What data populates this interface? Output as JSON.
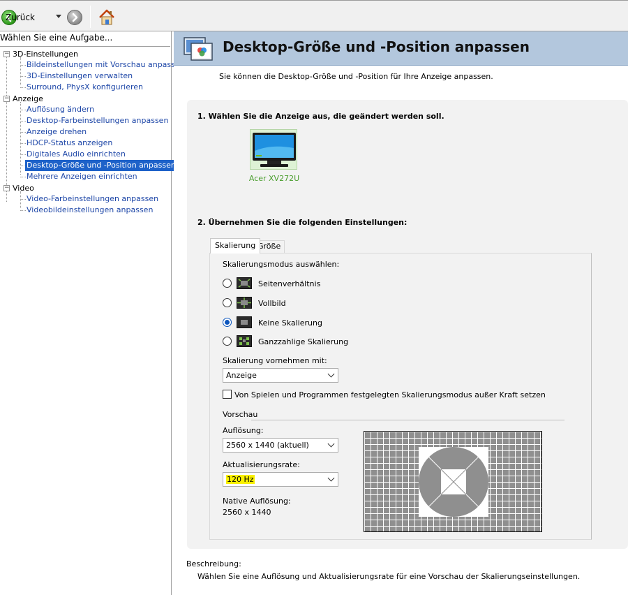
{
  "toolbar": {
    "back_label": "Zurück"
  },
  "left_panel": {
    "header": "Wählen Sie eine Aufgabe...",
    "categories": [
      {
        "label": "3D-Einstellungen",
        "items": [
          "Bildeinstellungen mit Vorschau anpassen",
          "3D-Einstellungen verwalten",
          "Surround, PhysX konfigurieren"
        ]
      },
      {
        "label": "Anzeige",
        "items": [
          "Auflösung ändern",
          "Desktop-Farbeinstellungen anpassen",
          "Anzeige drehen",
          "HDCP-Status anzeigen",
          "Digitales Audio einrichten",
          "Desktop-Größe und -Position anpassen",
          "Mehrere Anzeigen einrichten"
        ]
      },
      {
        "label": "Video",
        "items": [
          "Video-Farbeinstellungen anpassen",
          "Videobildeinstellungen anpassen"
        ]
      }
    ],
    "selected_item": "Desktop-Größe und -Position anpassen"
  },
  "page": {
    "title": "Desktop-Größe und -Position anpassen",
    "subtitle": "Sie können die Desktop-Größe und -Position für Ihre Anzeige anpassen."
  },
  "section1": {
    "heading": "1. Wählen Sie die Anzeige aus, die geändert werden soll.",
    "monitor_label": "Acer XV272U"
  },
  "section2": {
    "heading": "2. Übernehmen Sie die folgenden Einstellungen:",
    "tabs": [
      "Skalierung",
      "Größe"
    ],
    "active_tab": "Skalierung"
  },
  "scaling": {
    "mode_label": "Skalierungsmodus auswählen:",
    "options": [
      {
        "label": "Seitenverhältnis",
        "selected": false
      },
      {
        "label": "Vollbild",
        "selected": false
      },
      {
        "label": "Keine Skalierung",
        "selected": true
      },
      {
        "label": "Ganzzahlige Skalierung",
        "selected": false
      }
    ],
    "perform_label": "Skalierung vornehmen mit:",
    "perform_value": "Anzeige",
    "override_label": "Von Spielen und Programmen festgelegten Skalierungsmodus außer Kraft setzen",
    "override_checked": false
  },
  "preview": {
    "section_label": "Vorschau",
    "resolution_label": "Auflösung:",
    "resolution_value": "2560 x 1440 (aktuell)",
    "refresh_label": "Aktualisierungsrate:",
    "refresh_value": "120 Hz",
    "native_label": "Native Auflösung:",
    "native_value": "2560 x 1440"
  },
  "description": {
    "heading": "Beschreibung:",
    "text": "Wählen Sie eine Auflösung und Aktualisierungsrate für eine Vorschau der Skalierungseinstellungen."
  },
  "colors": {
    "banner": "#b3c7dd",
    "selection": "#1e62c9",
    "link": "#1d46a7",
    "monitor_label": "#4a9e2d",
    "highlight": "#f9f000"
  }
}
